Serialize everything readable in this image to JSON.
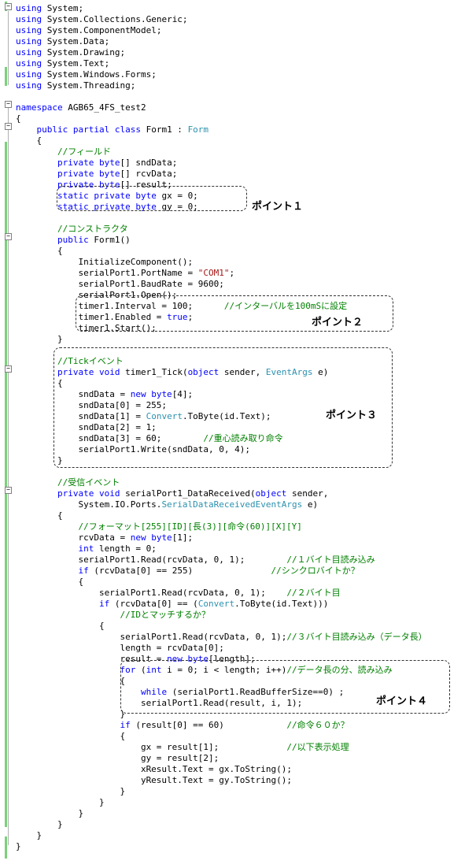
{
  "colors": {
    "keyword": "#0000ff",
    "comment": "#008000",
    "type": "#2b91af",
    "string": "#a31515",
    "text": "#000000",
    "change_bar": "#7bd07b"
  },
  "lines": [
    [
      [
        "kw",
        "using"
      ],
      [
        "t",
        " System;"
      ]
    ],
    [
      [
        "kw",
        "using"
      ],
      [
        "t",
        " System.Collections.Generic;"
      ]
    ],
    [
      [
        "kw",
        "using"
      ],
      [
        "t",
        " System.ComponentModel;"
      ]
    ],
    [
      [
        "kw",
        "using"
      ],
      [
        "t",
        " System.Data;"
      ]
    ],
    [
      [
        "kw",
        "using"
      ],
      [
        "t",
        " System.Drawing;"
      ]
    ],
    [
      [
        "kw",
        "using"
      ],
      [
        "t",
        " System.Text;"
      ]
    ],
    [
      [
        "kw",
        "using"
      ],
      [
        "t",
        " System.Windows.Forms;"
      ]
    ],
    [
      [
        "kw",
        "using"
      ],
      [
        "t",
        " System.Threading;"
      ]
    ],
    [],
    [
      [
        "kw",
        "namespace"
      ],
      [
        "t",
        " AGB65_4FS_test2"
      ]
    ],
    [
      [
        "t",
        "{"
      ]
    ],
    [
      [
        "t",
        "    "
      ],
      [
        "kw",
        "public partial class"
      ],
      [
        "t",
        " Form1 : "
      ],
      [
        "ty",
        "Form"
      ]
    ],
    [
      [
        "t",
        "    {"
      ]
    ],
    [
      [
        "t",
        "        "
      ],
      [
        "cm",
        "//フィールド"
      ]
    ],
    [
      [
        "t",
        "        "
      ],
      [
        "kw",
        "private byte"
      ],
      [
        "t",
        "[] sndData;"
      ]
    ],
    [
      [
        "t",
        "        "
      ],
      [
        "kw",
        "private byte"
      ],
      [
        "t",
        "[] rcvData;"
      ]
    ],
    [
      [
        "t",
        "        "
      ],
      [
        "kw",
        "private byte"
      ],
      [
        "t",
        "[] result;"
      ]
    ],
    [
      [
        "t",
        "        "
      ],
      [
        "kw",
        "static private byte"
      ],
      [
        "t",
        " gx = 0;"
      ]
    ],
    [
      [
        "t",
        "        "
      ],
      [
        "kw",
        "static private byte"
      ],
      [
        "t",
        " gy = 0;"
      ]
    ],
    [],
    [
      [
        "t",
        "        "
      ],
      [
        "cm",
        "//コンストラクタ"
      ]
    ],
    [
      [
        "t",
        "        "
      ],
      [
        "kw",
        "public"
      ],
      [
        "t",
        " Form1()"
      ]
    ],
    [
      [
        "t",
        "        {"
      ]
    ],
    [
      [
        "t",
        "            InitializeComponent();"
      ]
    ],
    [
      [
        "t",
        "            serialPort1.PortName = "
      ],
      [
        "st",
        "\"COM1\""
      ],
      [
        "t",
        ";"
      ]
    ],
    [
      [
        "t",
        "            serialPort1.BaudRate = 9600;"
      ]
    ],
    [
      [
        "t",
        "            serialPort1.Open();"
      ]
    ],
    [
      [
        "t",
        "            timer1.Interval = 100;      "
      ],
      [
        "cm",
        "//インターバルを100mSに設定"
      ]
    ],
    [
      [
        "t",
        "            timer1.Enabled = "
      ],
      [
        "kw",
        "true"
      ],
      [
        "t",
        ";"
      ]
    ],
    [
      [
        "t",
        "            timer1.Start();"
      ]
    ],
    [
      [
        "t",
        "        }"
      ]
    ],
    [],
    [
      [
        "t",
        "        "
      ],
      [
        "cm",
        "//Tickイベント"
      ]
    ],
    [
      [
        "t",
        "        "
      ],
      [
        "kw",
        "private void"
      ],
      [
        "t",
        " timer1_Tick("
      ],
      [
        "kw",
        "object"
      ],
      [
        "t",
        " sender, "
      ],
      [
        "ty",
        "EventArgs"
      ],
      [
        "t",
        " e)"
      ]
    ],
    [
      [
        "t",
        "        {"
      ]
    ],
    [
      [
        "t",
        "            sndData = "
      ],
      [
        "kw",
        "new byte"
      ],
      [
        "t",
        "[4];"
      ]
    ],
    [
      [
        "t",
        "            sndData[0] = 255;"
      ]
    ],
    [
      [
        "t",
        "            sndData[1] = "
      ],
      [
        "ty",
        "Convert"
      ],
      [
        "t",
        ".ToByte(id.Text);"
      ]
    ],
    [
      [
        "t",
        "            sndData[2] = 1;"
      ]
    ],
    [
      [
        "t",
        "            sndData[3] = 60;        "
      ],
      [
        "cm",
        "//重心読み取り命令"
      ]
    ],
    [
      [
        "t",
        "            serialPort1.Write(sndData, 0, 4);"
      ]
    ],
    [
      [
        "t",
        "        }"
      ]
    ],
    [],
    [
      [
        "t",
        "        "
      ],
      [
        "cm",
        "//受信イベント"
      ]
    ],
    [
      [
        "t",
        "        "
      ],
      [
        "kw",
        "private void"
      ],
      [
        "t",
        " serialPort1_DataReceived("
      ],
      [
        "kw",
        "object"
      ],
      [
        "t",
        " sender,"
      ]
    ],
    [
      [
        "t",
        "            System.IO.Ports."
      ],
      [
        "ty",
        "SerialDataReceivedEventArgs"
      ],
      [
        "t",
        " e)"
      ]
    ],
    [
      [
        "t",
        "        {"
      ]
    ],
    [
      [
        "t",
        "            "
      ],
      [
        "cm",
        "//フォーマット[255][ID][長(3)][命令(60)][X][Y]"
      ]
    ],
    [
      [
        "t",
        "            rcvData = "
      ],
      [
        "kw",
        "new byte"
      ],
      [
        "t",
        "[1];"
      ]
    ],
    [
      [
        "t",
        "            "
      ],
      [
        "kw",
        "int"
      ],
      [
        "t",
        " length = 0;"
      ]
    ],
    [
      [
        "t",
        "            serialPort1.Read(rcvData, 0, 1);        "
      ],
      [
        "cm",
        "//１バイト目読み込み"
      ]
    ],
    [
      [
        "t",
        "            "
      ],
      [
        "kw",
        "if"
      ],
      [
        "t",
        " (rcvData[0] == 255)               "
      ],
      [
        "cm",
        "//シンクロバイトか？"
      ]
    ],
    [
      [
        "t",
        "            {"
      ]
    ],
    [
      [
        "t",
        "                serialPort1.Read(rcvData, 0, 1);    "
      ],
      [
        "cm",
        "//２バイト目"
      ]
    ],
    [
      [
        "t",
        "                "
      ],
      [
        "kw",
        "if"
      ],
      [
        "t",
        " (rcvData[0] == ("
      ],
      [
        "ty",
        "Convert"
      ],
      [
        "t",
        ".ToByte(id.Text)))"
      ]
    ],
    [
      [
        "t",
        "                    "
      ],
      [
        "cm",
        "//IDとマッチするか？"
      ]
    ],
    [
      [
        "t",
        "                {"
      ]
    ],
    [
      [
        "t",
        "                    serialPort1.Read(rcvData, 0, 1);"
      ],
      [
        "cm",
        "//３バイト目読み込み（データ長）"
      ]
    ],
    [
      [
        "t",
        "                    length = rcvData[0];"
      ]
    ],
    [
      [
        "t",
        "                    result = "
      ],
      [
        "kw",
        "new byte"
      ],
      [
        "t",
        "[length];"
      ]
    ],
    [
      [
        "t",
        "                    "
      ],
      [
        "kw",
        "for"
      ],
      [
        "t",
        " ("
      ],
      [
        "kw",
        "int"
      ],
      [
        "t",
        " i = 0; i < length; i++)"
      ],
      [
        "cm",
        "//データ長の分、読み込み"
      ]
    ],
    [
      [
        "t",
        "                    {"
      ]
    ],
    [
      [
        "t",
        "                        "
      ],
      [
        "kw",
        "while"
      ],
      [
        "t",
        " (serialPort1.ReadBufferSize==0) ;"
      ]
    ],
    [
      [
        "t",
        "                        serialPort1.Read(result, i, 1);"
      ]
    ],
    [
      [
        "t",
        "                    }"
      ]
    ],
    [
      [
        "t",
        "                    "
      ],
      [
        "kw",
        "if"
      ],
      [
        "t",
        " (result[0] == 60)            "
      ],
      [
        "cm",
        "//命令６０か？"
      ]
    ],
    [
      [
        "t",
        "                    {"
      ]
    ],
    [
      [
        "t",
        "                        gx = result[1];             "
      ],
      [
        "cm",
        "//以下表示処理"
      ]
    ],
    [
      [
        "t",
        "                        gy = result[2];"
      ]
    ],
    [
      [
        "t",
        "                        xResult.Text = gx.ToString();"
      ]
    ],
    [
      [
        "t",
        "                        yResult.Text = gy.ToString();"
      ]
    ],
    [
      [
        "t",
        "                    }"
      ]
    ],
    [
      [
        "t",
        "                }"
      ]
    ],
    [
      [
        "t",
        "            }"
      ]
    ],
    [
      [
        "t",
        "        }"
      ]
    ],
    [
      [
        "t",
        "    }"
      ]
    ],
    [
      [
        "t",
        "}"
      ]
    ]
  ],
  "callouts": [
    {
      "label": "ポイント１"
    },
    {
      "label": "ポイント２"
    },
    {
      "label": "ポイント３"
    },
    {
      "label": "ポイント４"
    }
  ]
}
